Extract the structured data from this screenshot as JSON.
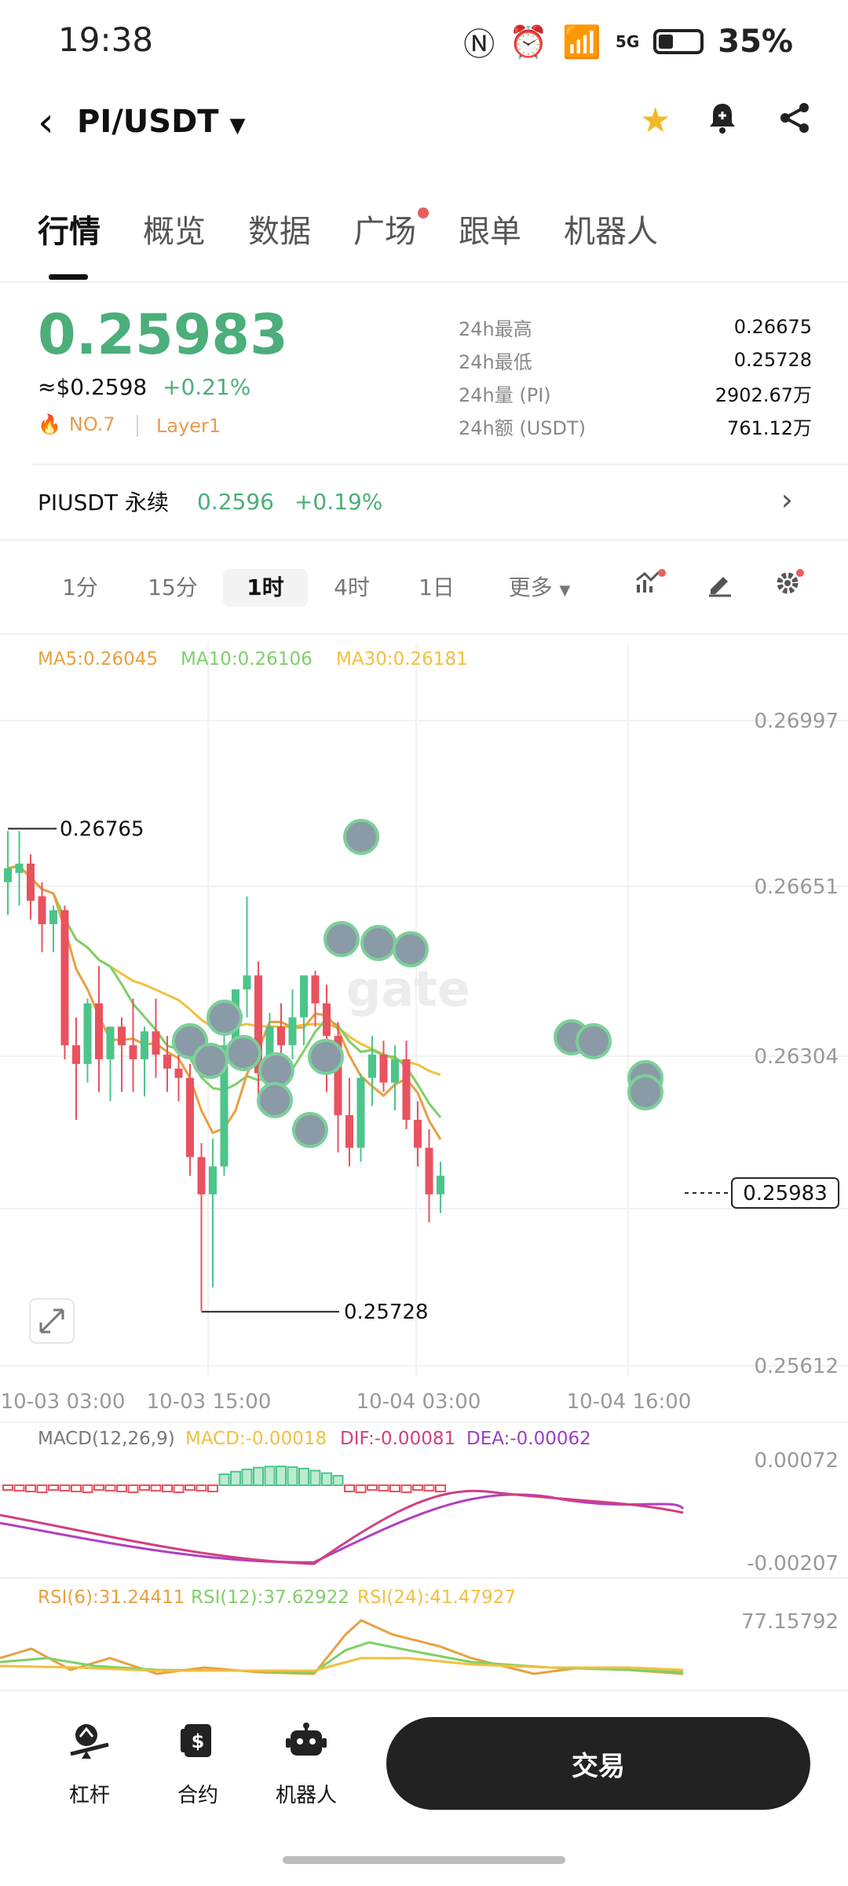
{
  "status": {
    "time": "19:38",
    "network": "5G",
    "battery": "35%"
  },
  "header": {
    "pair": "PI/USDT",
    "back_icon": "back-arrow-icon",
    "star_icon": "star-icon",
    "bell_icon": "bell-icon",
    "share_icon": "share-icon"
  },
  "tabs": [
    {
      "label": "行情",
      "active": true
    },
    {
      "label": "概览"
    },
    {
      "label": "数据"
    },
    {
      "label": "广场",
      "dot": true
    },
    {
      "label": "跟单"
    },
    {
      "label": "机器人"
    }
  ],
  "ticker": {
    "price": "0.25983",
    "fiat": "≈$0.2598",
    "change": "+0.21%",
    "rank": "NO.7",
    "tag": "Layer1",
    "stats": [
      {
        "label": "24h最高",
        "value": "0.26675"
      },
      {
        "label": "24h最低",
        "value": "0.25728"
      },
      {
        "label": "24h量 (PI)",
        "value": "2902.67万"
      },
      {
        "label": "24h额 (USDT)",
        "value": "761.12万"
      }
    ]
  },
  "perpetual": {
    "name": "PIUSDT 永续",
    "price": "0.2596",
    "change": "+0.19%"
  },
  "intervals": {
    "items": [
      "1分",
      "15分",
      "1时",
      "4时",
      "1日",
      "更多"
    ],
    "active": "1时"
  },
  "chart_data": {
    "type": "candlestick",
    "ma_labels": {
      "ma5": "MA5:0.26045",
      "ma10": "MA10:0.26106",
      "ma30": "MA30:0.26181"
    },
    "y_ticks": [
      "0.26997",
      "0.26651",
      "0.26304",
      "0.25612"
    ],
    "x_ticks": [
      "10-03 03:00",
      "10-03 15:00",
      "10-04 03:00",
      "10-04 16:00"
    ],
    "high_label": "0.26765",
    "low_label": "0.25728",
    "last_price": "0.25983",
    "colors": {
      "up": "#4cc48a",
      "down": "#e9525f",
      "ma5": "#e8a040",
      "ma10": "#7ed067",
      "ma30": "#f0c040"
    },
    "candles": [
      {
        "o": 0.2665,
        "h": 0.2676,
        "l": 0.2658,
        "c": 0.2668
      },
      {
        "o": 0.2667,
        "h": 0.2676,
        "l": 0.266,
        "c": 0.2669
      },
      {
        "o": 0.2669,
        "h": 0.2671,
        "l": 0.2657,
        "c": 0.2661
      },
      {
        "o": 0.2662,
        "h": 0.2665,
        "l": 0.265,
        "c": 0.2656
      },
      {
        "o": 0.2656,
        "h": 0.266,
        "l": 0.265,
        "c": 0.2659
      },
      {
        "o": 0.2659,
        "h": 0.266,
        "l": 0.2627,
        "c": 0.263
      },
      {
        "o": 0.263,
        "h": 0.2636,
        "l": 0.2614,
        "c": 0.2626
      },
      {
        "o": 0.2626,
        "h": 0.264,
        "l": 0.2622,
        "c": 0.2639
      },
      {
        "o": 0.2639,
        "h": 0.2647,
        "l": 0.262,
        "c": 0.2627
      },
      {
        "o": 0.2627,
        "h": 0.2634,
        "l": 0.2618,
        "c": 0.2634
      },
      {
        "o": 0.2634,
        "h": 0.2636,
        "l": 0.262,
        "c": 0.263
      },
      {
        "o": 0.263,
        "h": 0.264,
        "l": 0.262,
        "c": 0.2627
      },
      {
        "o": 0.2627,
        "h": 0.2634,
        "l": 0.2619,
        "c": 0.2633
      },
      {
        "o": 0.2633,
        "h": 0.264,
        "l": 0.2623,
        "c": 0.2628
      },
      {
        "o": 0.2628,
        "h": 0.2632,
        "l": 0.262,
        "c": 0.2625
      },
      {
        "o": 0.2625,
        "h": 0.263,
        "l": 0.2618,
        "c": 0.2623
      },
      {
        "o": 0.2623,
        "h": 0.2626,
        "l": 0.2602,
        "c": 0.2606
      },
      {
        "o": 0.2606,
        "h": 0.2609,
        "l": 0.2573,
        "c": 0.2598
      },
      {
        "o": 0.2598,
        "h": 0.261,
        "l": 0.2578,
        "c": 0.2604
      },
      {
        "o": 0.2604,
        "h": 0.2633,
        "l": 0.2602,
        "c": 0.263
      },
      {
        "o": 0.263,
        "h": 0.2642,
        "l": 0.2628,
        "c": 0.2642
      },
      {
        "o": 0.2642,
        "h": 0.2662,
        "l": 0.2636,
        "c": 0.2645
      },
      {
        "o": 0.2645,
        "h": 0.2648,
        "l": 0.2618,
        "c": 0.2624
      },
      {
        "o": 0.2624,
        "h": 0.2637,
        "l": 0.2622,
        "c": 0.2634
      },
      {
        "o": 0.2634,
        "h": 0.2639,
        "l": 0.2626,
        "c": 0.263
      },
      {
        "o": 0.263,
        "h": 0.2642,
        "l": 0.2627,
        "c": 0.2636
      },
      {
        "o": 0.2636,
        "h": 0.2645,
        "l": 0.263,
        "c": 0.2645
      },
      {
        "o": 0.2645,
        "h": 0.2646,
        "l": 0.2634,
        "c": 0.2639
      },
      {
        "o": 0.2639,
        "h": 0.2643,
        "l": 0.262,
        "c": 0.2632
      },
      {
        "o": 0.2632,
        "h": 0.2635,
        "l": 0.2607,
        "c": 0.2615
      },
      {
        "o": 0.2615,
        "h": 0.2623,
        "l": 0.2604,
        "c": 0.2608
      },
      {
        "o": 0.2608,
        "h": 0.2624,
        "l": 0.2605,
        "c": 0.2623
      },
      {
        "o": 0.2623,
        "h": 0.2632,
        "l": 0.2617,
        "c": 0.2628
      },
      {
        "o": 0.2628,
        "h": 0.2631,
        "l": 0.262,
        "c": 0.2622
      },
      {
        "o": 0.2622,
        "h": 0.263,
        "l": 0.2616,
        "c": 0.2627
      },
      {
        "o": 0.2627,
        "h": 0.2631,
        "l": 0.2612,
        "c": 0.2614
      },
      {
        "o": 0.2614,
        "h": 0.2618,
        "l": 0.2604,
        "c": 0.2608
      },
      {
        "o": 0.2608,
        "h": 0.2612,
        "l": 0.2592,
        "c": 0.2598
      },
      {
        "o": 0.2598,
        "h": 0.2605,
        "l": 0.2594,
        "c": 0.2602
      }
    ],
    "macd_label": "MACD(12,26,9)",
    "macd_values": {
      "macd": "MACD:-0.00018",
      "dif": "DIF:-0.00081",
      "dea": "DEA:-0.00062"
    },
    "macd_ticks": [
      "0.00072",
      "-0.00207"
    ],
    "rsi_values": {
      "rsi6": "RSI(6):31.24411",
      "rsi12": "RSI(12):37.62922",
      "rsi24": "RSI(24):41.47927"
    },
    "rsi_tick": "77.15792",
    "watermark": "gate"
  },
  "bottom_nav": {
    "items": [
      {
        "label": "杠杆",
        "icon": "leverage-icon"
      },
      {
        "label": "合约",
        "icon": "contract-icon"
      },
      {
        "label": "机器人",
        "icon": "robot-icon"
      }
    ],
    "trade_label": "交易"
  }
}
